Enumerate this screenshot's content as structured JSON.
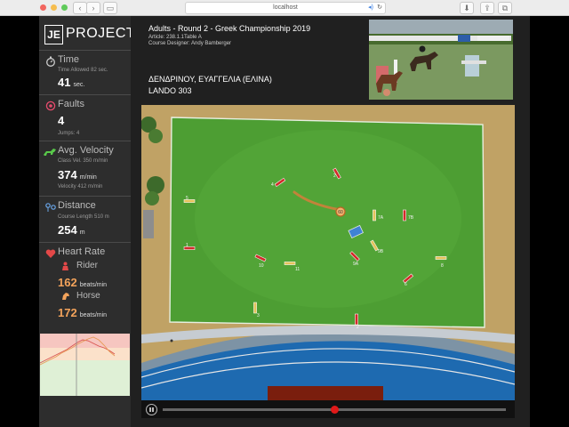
{
  "browser": {
    "url": "localhost",
    "dots": [
      "#f2665f",
      "#f6bd4f",
      "#5fca5a"
    ]
  },
  "logo": {
    "box": "JE",
    "word": "PROJECT"
  },
  "stats": {
    "time": {
      "title": "Time",
      "sub": "Time Allowed 82 sec.",
      "value": "41",
      "unit": "sec."
    },
    "faults": {
      "title": "Faults",
      "value": "4",
      "sub": "Jumps: 4"
    },
    "velocity": {
      "title": "Avg. Velocity",
      "sub1": "Class Vel. 350 m/min",
      "value": "374",
      "unit": "m/min",
      "sub2": "Velocity 412 m/min"
    },
    "distance": {
      "title": "Distance",
      "sub": "Course Length 510 m",
      "value": "254",
      "unit": "m"
    },
    "heart": {
      "title": "Heart Rate",
      "rider_label": "Rider",
      "rider_value": "162",
      "rider_unit": "beats/min",
      "horse_label": "Horse",
      "horse_value": "172",
      "horse_unit": "beats/min"
    }
  },
  "event": {
    "title": "Adults - Round 2 - Greek Championship 2019",
    "article": "Article: 238.1.1Table A",
    "designer": "Course Designer: Andy Bamberger",
    "rider": "ΔΕΝΔΡΙΝΟΥ, ΕΥΑΓΓΕΛΙΑ (ΕΛΙΝΑ)",
    "horse": "LANDO 303"
  },
  "fences": [
    {
      "label": "4",
      "angle": -35
    },
    {
      "label": "2",
      "angle": 60
    },
    {
      "label": "5",
      "angle": 0
    },
    {
      "label": "7A",
      "angle": 90
    },
    {
      "label": "7B",
      "angle": 90
    },
    {
      "label": "9B",
      "angle": 60
    },
    {
      "label": "9A",
      "angle": 45
    },
    {
      "label": "10",
      "angle": 25
    },
    {
      "label": "11",
      "angle": 0
    },
    {
      "label": "8",
      "angle": 0
    },
    {
      "label": "6",
      "angle": -40
    },
    {
      "label": "3",
      "angle": 90
    },
    {
      "label": "2",
      "angle": 90
    },
    {
      "label": "1",
      "angle": 0
    }
  ],
  "horse_position_label": "60",
  "playback": {
    "progress": 0.5
  }
}
